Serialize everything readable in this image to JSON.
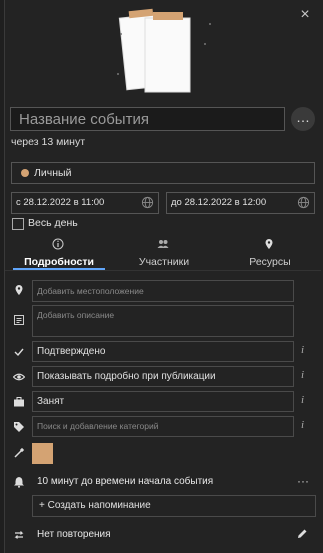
{
  "window": {
    "close_label": "×"
  },
  "header": {
    "title_placeholder": "Название события",
    "more_label": "…",
    "time_until": "через 13 минут"
  },
  "calendar": {
    "name": "Личный",
    "color": "#d4a373"
  },
  "dates": {
    "start": "с 28.12.2022 в 11:00",
    "end": "до 28.12.2022 в 12:00"
  },
  "all_day": {
    "label": "Весь день",
    "checked": false
  },
  "tabs": [
    {
      "label": "Подробности",
      "active": true
    },
    {
      "label": "Участники",
      "active": false
    },
    {
      "label": "Ресурсы",
      "active": false
    }
  ],
  "details": {
    "location_placeholder": "Добавить местоположение",
    "description_placeholder": "Добавить описание",
    "status": "Подтверждено",
    "visibility": "Показывать подробно при публикации",
    "busy": "Занят",
    "categories_placeholder": "Поиск и добавление категорий",
    "info_label": "i",
    "color": "#d4a373"
  },
  "reminder": {
    "text": "10 минут до времени начала события",
    "more_label": "···",
    "add_label": "+ Создать напоминание"
  },
  "repeat": {
    "text": "Нет повторения"
  }
}
